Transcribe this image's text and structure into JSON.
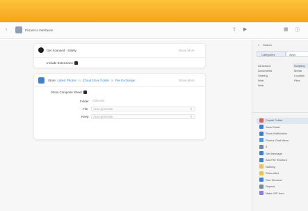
{
  "window": {
    "title": "Picture to Interfaces"
  },
  "cards": {
    "step1": {
      "title": "Get Scanned · Safely",
      "action": "Show More",
      "toggle_label": "Include Extensions"
    },
    "step2": {
      "verb": "Store",
      "input": "Latest Photos",
      "prep1": "to",
      "target": "iCloud Drive Folder",
      "prep2": "in",
      "location": "File Exchange",
      "action": "Show More",
      "toggle_label": "Show Compose Sheet",
      "fields": [
        {
          "label": "Folder",
          "placeholder": "Optional"
        },
        {
          "label": "File",
          "placeholder": "Auto-generate"
        },
        {
          "label": "Keep",
          "placeholder": "Auto-generate"
        }
      ]
    }
  },
  "sidebar": {
    "search_placeholder": "Search",
    "tabs": [
      "Categories",
      "Apps"
    ],
    "categories": [
      "All Actions",
      "Documents",
      "Sharing",
      "Web"
    ],
    "categories_right": [
      "Scripting",
      "Media",
      "Location",
      "Files"
    ],
    "actions": [
      {
        "label": "Create Folder",
        "color": "#e05e5e"
      },
      {
        "label": "Save Email",
        "color": "#3b82d6"
      },
      {
        "label": "Show Notification",
        "color": "#3b82d6"
      },
      {
        "label": "Photos Chat Menu",
        "color": "#4a9be8"
      },
      {
        "label": "If",
        "color": "#7a8797"
      },
      {
        "label": "Get Message",
        "color": "#3b82d6"
      },
      {
        "label": "Add File Shortcut",
        "color": "#3b82d6"
      },
      {
        "label": "Nothing",
        "color": "#f0c04a"
      },
      {
        "label": "Show Alert",
        "color": "#f0c04a"
      },
      {
        "label": "Run Shortcut",
        "color": "#3b82d6"
      },
      {
        "label": "Repeat",
        "color": "#7a8797"
      },
      {
        "label": "Make GIF from",
        "color": "#8c7be0"
      }
    ]
  }
}
